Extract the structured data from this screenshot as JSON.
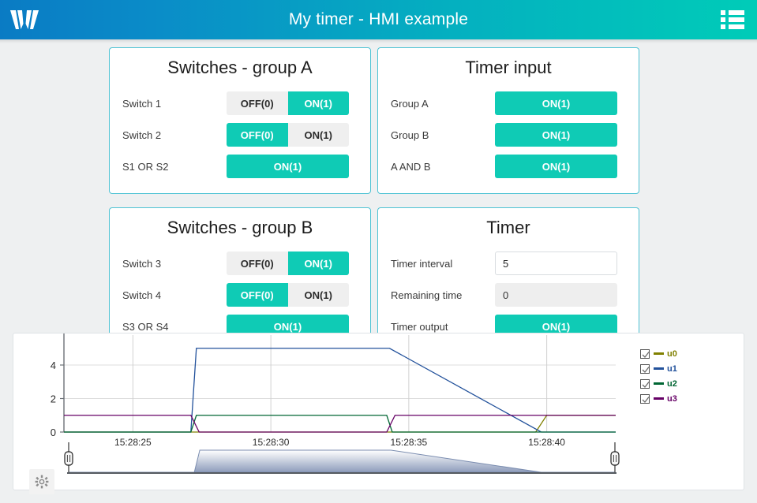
{
  "header": {
    "title": "My timer - HMI example",
    "logo_icon": "w-logo-icon",
    "menu_icon": "list-menu-icon"
  },
  "panels": [
    {
      "id": "switches-group-a",
      "title": "Switches - group A",
      "rows": [
        {
          "label": "Switch 1",
          "type": "toggle",
          "options": [
            "OFF(0)",
            "ON(1)"
          ],
          "selected": 1
        },
        {
          "label": "Switch 2",
          "type": "toggle",
          "options": [
            "OFF(0)",
            "ON(1)"
          ],
          "selected": 0
        },
        {
          "label": "S1 OR S2",
          "type": "state",
          "value": "ON(1)"
        }
      ]
    },
    {
      "id": "timer-input",
      "title": "Timer input",
      "rows": [
        {
          "label": "Group A",
          "type": "state",
          "value": "ON(1)"
        },
        {
          "label": "Group B",
          "type": "state",
          "value": "ON(1)"
        },
        {
          "label": "A AND B",
          "type": "state",
          "value": "ON(1)"
        }
      ]
    },
    {
      "id": "switches-group-b",
      "title": "Switches - group B",
      "rows": [
        {
          "label": "Switch 3",
          "type": "toggle",
          "options": [
            "OFF(0)",
            "ON(1)"
          ],
          "selected": 1
        },
        {
          "label": "Switch 4",
          "type": "toggle",
          "options": [
            "OFF(0)",
            "ON(1)"
          ],
          "selected": 0
        },
        {
          "label": "S3 OR S4",
          "type": "state",
          "value": "ON(1)"
        }
      ]
    },
    {
      "id": "timer",
      "title": "Timer",
      "rows": [
        {
          "label": "Timer interval",
          "type": "input",
          "value": "5",
          "placeholder": ""
        },
        {
          "label": "Remaining time",
          "type": "readonly",
          "value": "0"
        },
        {
          "label": "Timer output",
          "type": "state",
          "value": "ON(1)"
        }
      ]
    }
  ],
  "colors": {
    "accent_teal": "#0fcbb5",
    "card_border": "#4fc3d4",
    "brand_blue": "#0a7bc4",
    "series_u0": "#808000",
    "series_u1": "#22519b",
    "series_u2": "#006633",
    "series_u3": "#660066"
  },
  "chart_data": {
    "type": "line",
    "title": "",
    "xlabel": "",
    "ylabel": "",
    "grid": true,
    "legend_position": "right",
    "xlim": [
      "15:28:22.5",
      "15:28:42.5"
    ],
    "ylim": [
      0,
      5.6
    ],
    "yticks": [
      0,
      2,
      4
    ],
    "xticks": [
      "15:28:25",
      "15:28:30",
      "15:28:35",
      "15:28:40"
    ],
    "series": [
      {
        "name": "u0",
        "color": "#808000",
        "checked": true,
        "points": [
          {
            "t": "15:28:22.5",
            "v": 0
          },
          {
            "t": "15:28:39.6",
            "v": 0
          },
          {
            "t": "15:28:40.0",
            "v": 1
          },
          {
            "t": "15:28:42.5",
            "v": 1
          }
        ]
      },
      {
        "name": "u1",
        "color": "#22519b",
        "checked": true,
        "points": [
          {
            "t": "15:28:22.5",
            "v": 0
          },
          {
            "t": "15:28:27.1",
            "v": 0
          },
          {
            "t": "15:28:27.3",
            "v": 5
          },
          {
            "t": "15:28:34.3",
            "v": 5
          },
          {
            "t": "15:28:39.8",
            "v": 0
          },
          {
            "t": "15:28:42.5",
            "v": 0
          }
        ]
      },
      {
        "name": "u2",
        "color": "#006633",
        "checked": true,
        "points": [
          {
            "t": "15:28:22.5",
            "v": 0
          },
          {
            "t": "15:28:27.1",
            "v": 0
          },
          {
            "t": "15:28:27.3",
            "v": 1
          },
          {
            "t": "15:28:34.2",
            "v": 1
          },
          {
            "t": "15:28:34.4",
            "v": 0
          },
          {
            "t": "15:28:42.5",
            "v": 0
          }
        ]
      },
      {
        "name": "u3",
        "color": "#660066",
        "checked": true,
        "points": [
          {
            "t": "15:28:22.5",
            "v": 1
          },
          {
            "t": "15:28:27.1",
            "v": 1
          },
          {
            "t": "15:28:27.4",
            "v": 0
          },
          {
            "t": "15:28:34.2",
            "v": 0
          },
          {
            "t": "15:28:34.5",
            "v": 1
          },
          {
            "t": "15:28:42.5",
            "v": 1
          }
        ]
      }
    ]
  },
  "navigator": {
    "settings_icon": "gear-icon",
    "left_handle": "navigator-left-handle",
    "right_handle": "navigator-right-handle"
  }
}
